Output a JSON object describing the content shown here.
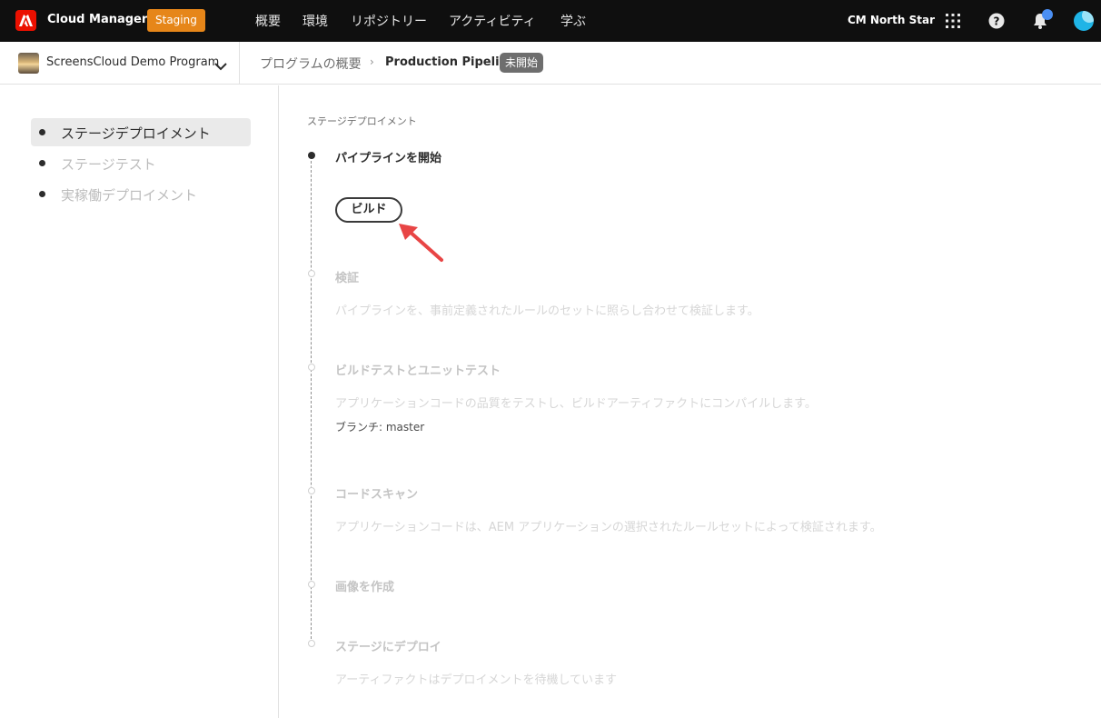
{
  "topbar": {
    "app_name": "Cloud Manager",
    "env_badge": "Staging",
    "nav": [
      "概要",
      "環境",
      "リポジトリー",
      "アクティビティ",
      "学ぶ"
    ],
    "org_name": "CM North Star",
    "icons": [
      "apps-grid-icon",
      "help-icon",
      "bell-icon",
      "user-avatar"
    ],
    "accent_color": "#eb1000",
    "badge_color": "#e68619"
  },
  "subbar": {
    "program_name": "ScreensCloud Demo Program",
    "breadcrumb_parent": "プログラムの概要",
    "breadcrumb_separator": "›",
    "pipeline_name": "Production Pipeline",
    "pipeline_status": "未開始"
  },
  "sidebar": {
    "items": [
      {
        "label": "ステージデプロイメント",
        "active": true
      },
      {
        "label": "ステージテスト",
        "active": false
      },
      {
        "label": "実稼働デプロイメント",
        "active": false
      }
    ]
  },
  "main": {
    "section_title": "ステージデプロイメント",
    "steps": [
      {
        "title": "パイプラインを開始",
        "description": "",
        "state": "done"
      },
      {
        "title": "ビルド",
        "description": "",
        "state": "highlighted"
      },
      {
        "title": "検証",
        "description": "パイプラインを、事前定義されたルールのセットに照らし合わせて検証します。",
        "state": "pending"
      },
      {
        "title": "ビルドテストとユニットテスト",
        "description": "アプリケーションコードの品質をテストし、ビルドアーティファクトにコンパイルします。",
        "branch": "ブランチ: master",
        "state": "pending"
      },
      {
        "title": "コードスキャン",
        "description": "アプリケーションコードは、AEM アプリケーションの選択されたルールセットによって検証されます。",
        "state": "pending"
      },
      {
        "title": "画像を作成",
        "description": "",
        "state": "pending"
      },
      {
        "title": "ステージにデプロイ",
        "description": "アーティファクトはデプロイメントを待機しています",
        "state": "pending"
      }
    ]
  }
}
